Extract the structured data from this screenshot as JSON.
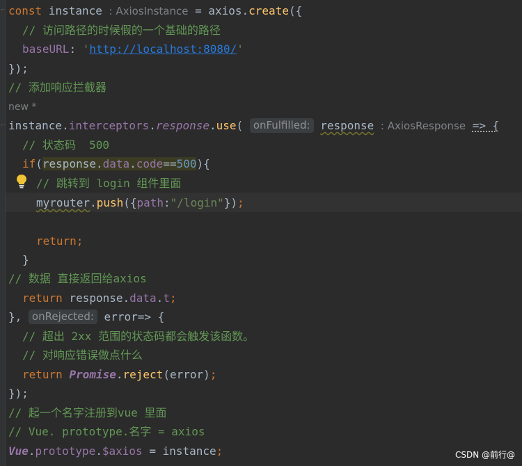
{
  "editor": {
    "theme": "darcula",
    "bg_color": "#2b2b2b",
    "code": {
      "l1_const": "const",
      "l1_instance": "instance",
      "l1_type_hint": ": AxiosInstance",
      "l1_eq": " = ",
      "l1_axios": "axios",
      "l1_dot": ".",
      "l1_create": "create",
      "l1_open": "({",
      "l2_comment": "// 访问路径的时候假的一个基础的路径",
      "l3_key": "baseURL",
      "l3_colon": ": ",
      "l3_quote_open": "'",
      "l3_url": "http://localhost:8080/",
      "l3_quote_close": "'",
      "l4_close": "});",
      "l5_comment": "// 添加响应拦截器",
      "usages_hint": "new *",
      "l6_instance": "instance",
      "l6_dot1": ".",
      "l6_interceptors": "interceptors",
      "l6_dot2": ".",
      "l6_response": "response",
      "l6_dot3": ".",
      "l6_use": "use",
      "l6_paren": "( ",
      "l6_param_hint": "onFulfilled:",
      "l6_param": "response",
      "l6_type_hint": ": AxiosResponse",
      "l6_arrow": "=> {",
      "l7_comment": "// 状态码  500",
      "l8_if": "if",
      "l8_paren": "(",
      "l8_response": "response",
      "l8_dot1": ".",
      "l8_data": "data",
      "l8_dot2": ".",
      "l8_code": "code",
      "l8_eq": "==",
      "l8_num": "500",
      "l8_close": "){",
      "l9_comment": "// 跳转到 login 组件里面",
      "l10_router": "myrouter",
      "l10_dot": ".",
      "l10_push": "push",
      "l10_open": "({",
      "l10_path": "path",
      "l10_colon": ":",
      "l10_str": "\"/login\"",
      "l10_close": "})",
      "l10_semi": ";",
      "l12_return": "return",
      "l12_semi": ";",
      "l13_brace": "}",
      "l14_comment": "// 数据 直接返回给axios",
      "l15_return": "return",
      "l15_response": " response",
      "l15_dot1": ".",
      "l15_data": "data",
      "l15_dot2": ".",
      "l15_t": "t",
      "l15_semi": ";",
      "l16_close": "},",
      "l16_param_hint": "onRejected:",
      "l16_error": " error=> {",
      "l17_comment": "// 超出 2xx 范围的状态码都会触发该函数。",
      "l18_comment": "// 对响应错误做点什么",
      "l19_return": "return",
      "l19_promise": "Promise",
      "l19_dot": ".",
      "l19_reject": "reject",
      "l19_args": "(error)",
      "l19_semi": ";",
      "l20_close": "});",
      "l21_comment": "// 起一个名字注册到vue 里面",
      "l22_comment": "// Vue. prototype.名字 = axios",
      "l23_vue": "Vue",
      "l23_dot1": ".",
      "l23_prototype": "prototype",
      "l23_dot2": ".",
      "l23_axios": "$axios",
      "l23_eq": " = instance",
      "l23_semi": ";"
    }
  },
  "icons": {
    "bulb": "lightbulb-icon"
  },
  "watermark": "CSDN @前行@"
}
